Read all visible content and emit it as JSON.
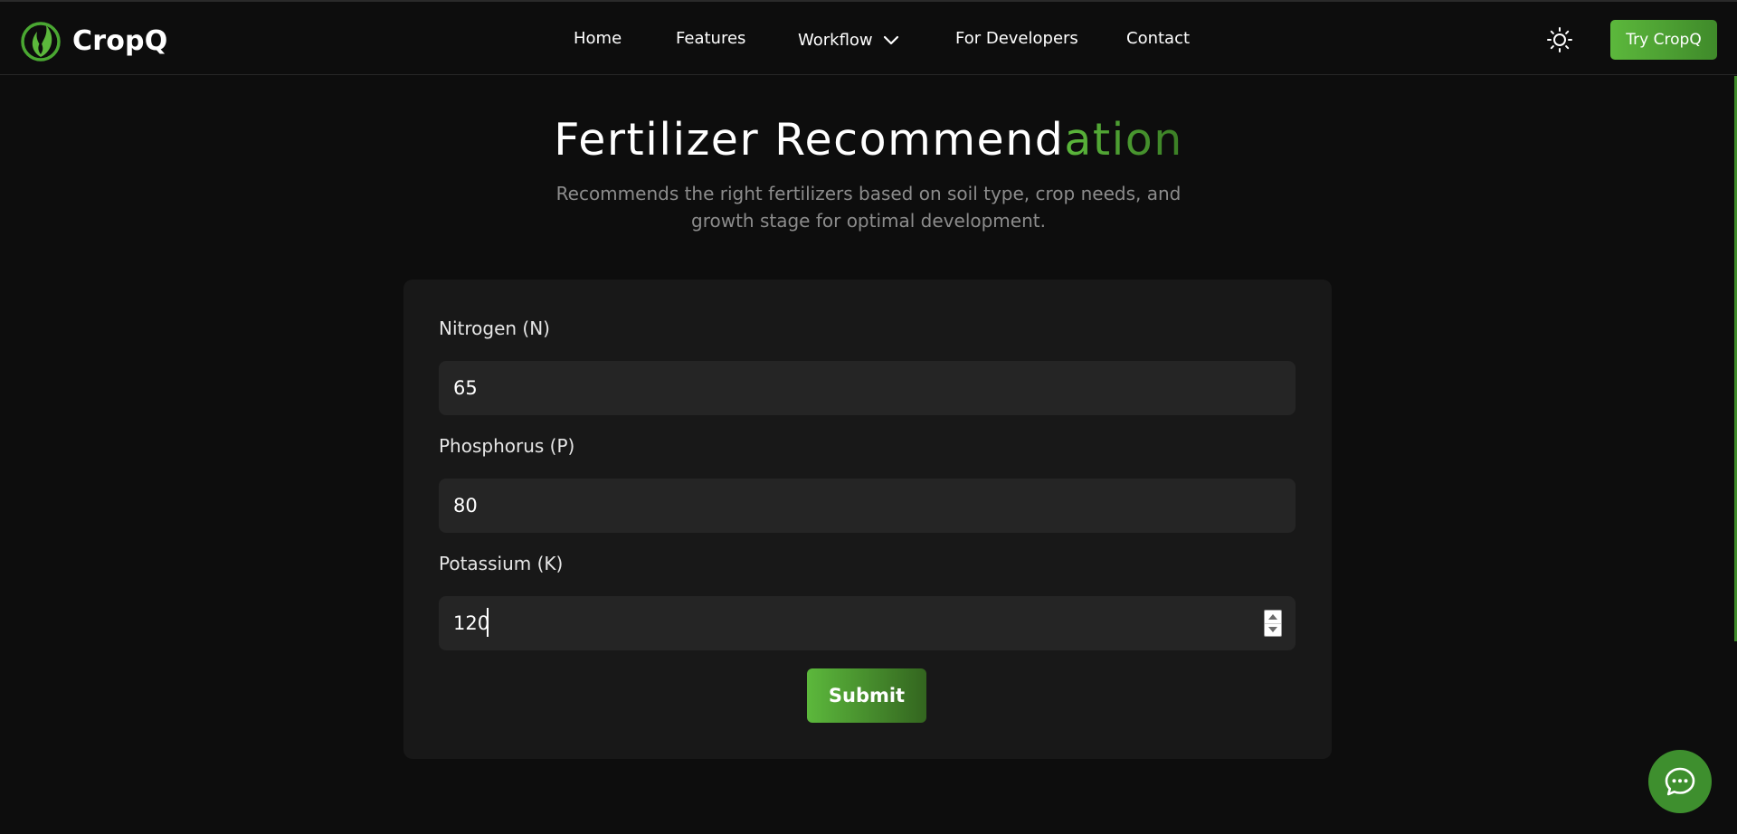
{
  "brand": {
    "name": "CropQ",
    "logo_icon": "leaf-flame-logo",
    "accent_color": "#5cb83c"
  },
  "nav": {
    "items": [
      {
        "label": "Home"
      },
      {
        "label": "Features"
      },
      {
        "label": "Workflow",
        "icon": "chevron-down-icon"
      },
      {
        "label": "For Developers"
      },
      {
        "label": "Contact"
      }
    ],
    "theme_toggle_icon": "sun-icon",
    "cta_label": "Try CropQ"
  },
  "header": {
    "title_main": "Fertilizer Recommend",
    "title_accent": "ation",
    "subtitle": "Recommends the right fertilizers based on soil type, crop needs, and growth stage for optimal development."
  },
  "form": {
    "fields": [
      {
        "label": "Nitrogen (N)",
        "value": "65"
      },
      {
        "label": "Phosphorus (P)",
        "value": "80"
      },
      {
        "label": "Potassium (K)",
        "value": "120"
      }
    ],
    "submit_label": "Submit"
  },
  "chat": {
    "icon": "chat-bubble-icon"
  },
  "colors": {
    "background": "#0d0d0d",
    "card": "#181818",
    "input": "#252525",
    "accent": "#5cb83c",
    "accent_dark": "#33651f",
    "subtitle": "#8c8c8c"
  }
}
